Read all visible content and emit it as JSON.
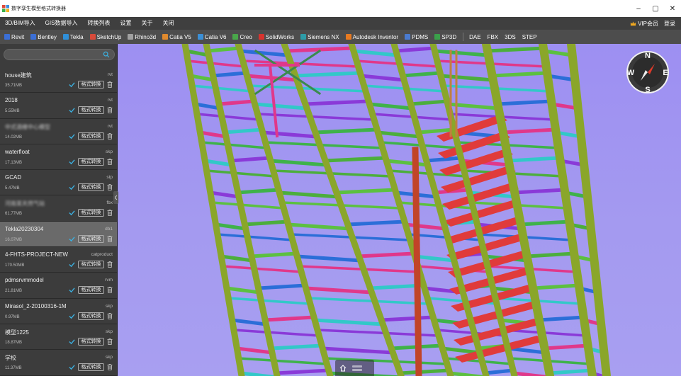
{
  "window": {
    "title": "数字孪生模型格式转换器",
    "minimize_glyph": "–",
    "maximize_glyph": "▢",
    "close_glyph": "✕"
  },
  "menu": {
    "items": [
      "3D/BIM导入",
      "GIS数据导入",
      "转换列表",
      "设置",
      "关于",
      "关闭"
    ],
    "vip_label": "VIP会员",
    "login_label": "登录"
  },
  "formats": {
    "items": [
      {
        "label": "Revit",
        "color": "#3b6fd6"
      },
      {
        "label": "Bentley",
        "color": "#3b6fd6"
      },
      {
        "label": "Tekla",
        "color": "#2f8fd8"
      },
      {
        "label": "SketchUp",
        "color": "#d84a3a"
      },
      {
        "label": "Rhino3d",
        "color": "#a0a0a0"
      },
      {
        "label": "Catia V5",
        "color": "#e08a2e"
      },
      {
        "label": "Catia V6",
        "color": "#3b8fd6"
      },
      {
        "label": "Creo",
        "color": "#49a64a"
      },
      {
        "label": "SolidWorks",
        "color": "#d8332e"
      },
      {
        "label": "Siemens NX",
        "color": "#2d9ca8"
      },
      {
        "label": "Autodesk Inventor",
        "color": "#e87a20"
      },
      {
        "label": "PDMS",
        "color": "#4a7bd0"
      },
      {
        "label": "SP3D",
        "color": "#3aa04a"
      }
    ],
    "plain": [
      "DAE",
      "FBX",
      "3DS",
      "STEP"
    ]
  },
  "search": {
    "placeholder": "",
    "value": ""
  },
  "files": [
    {
      "name": "house建筑",
      "ext": "rvt",
      "size": "35.71MB",
      "blurred": false,
      "selected": false
    },
    {
      "name": "2018",
      "ext": "rvt",
      "size": "5.55MB",
      "blurred": false,
      "selected": false
    },
    {
      "name": "中式酒楼中心模型",
      "ext": "rvt",
      "size": "14.02MB",
      "blurred": true,
      "selected": false
    },
    {
      "name": "waterfloat",
      "ext": "skp",
      "size": "17.13MB",
      "blurred": false,
      "selected": false
    },
    {
      "name": "GCAD",
      "ext": "stp",
      "size": "5.47MB",
      "blurred": false,
      "selected": false
    },
    {
      "name": "河南某天然气站",
      "ext": "fbx",
      "size": "61.77MB",
      "blurred": true,
      "selected": false
    },
    {
      "name": "Tekla20230304",
      "ext": "db1",
      "size": "16.07MB",
      "blurred": false,
      "selected": true
    },
    {
      "name": "4-FHTS-PROJECT-NEW",
      "ext": "catproduct",
      "size": "170.50MB",
      "blurred": false,
      "selected": false
    },
    {
      "name": "pdmsrvmmodel",
      "ext": "rvm",
      "size": "21.81MB",
      "blurred": false,
      "selected": false
    },
    {
      "name": "Mirasol_2-20100316-1M",
      "ext": "skp",
      "size": "0.97MB",
      "blurred": false,
      "selected": false
    },
    {
      "name": "模型1225",
      "ext": "skp",
      "size": "18.87MB",
      "blurred": false,
      "selected": false
    },
    {
      "name": "学校",
      "ext": "skp",
      "size": "11.37MB",
      "blurred": false,
      "selected": false
    }
  ],
  "convert_label": "格式转换",
  "compass": {
    "n": "N",
    "s": "S",
    "e": "E",
    "w": "W"
  },
  "colors": {
    "accent_check": "#3bb0e0",
    "viewport_bg": "#a69cf0",
    "vip_gold": "#f0a820"
  }
}
